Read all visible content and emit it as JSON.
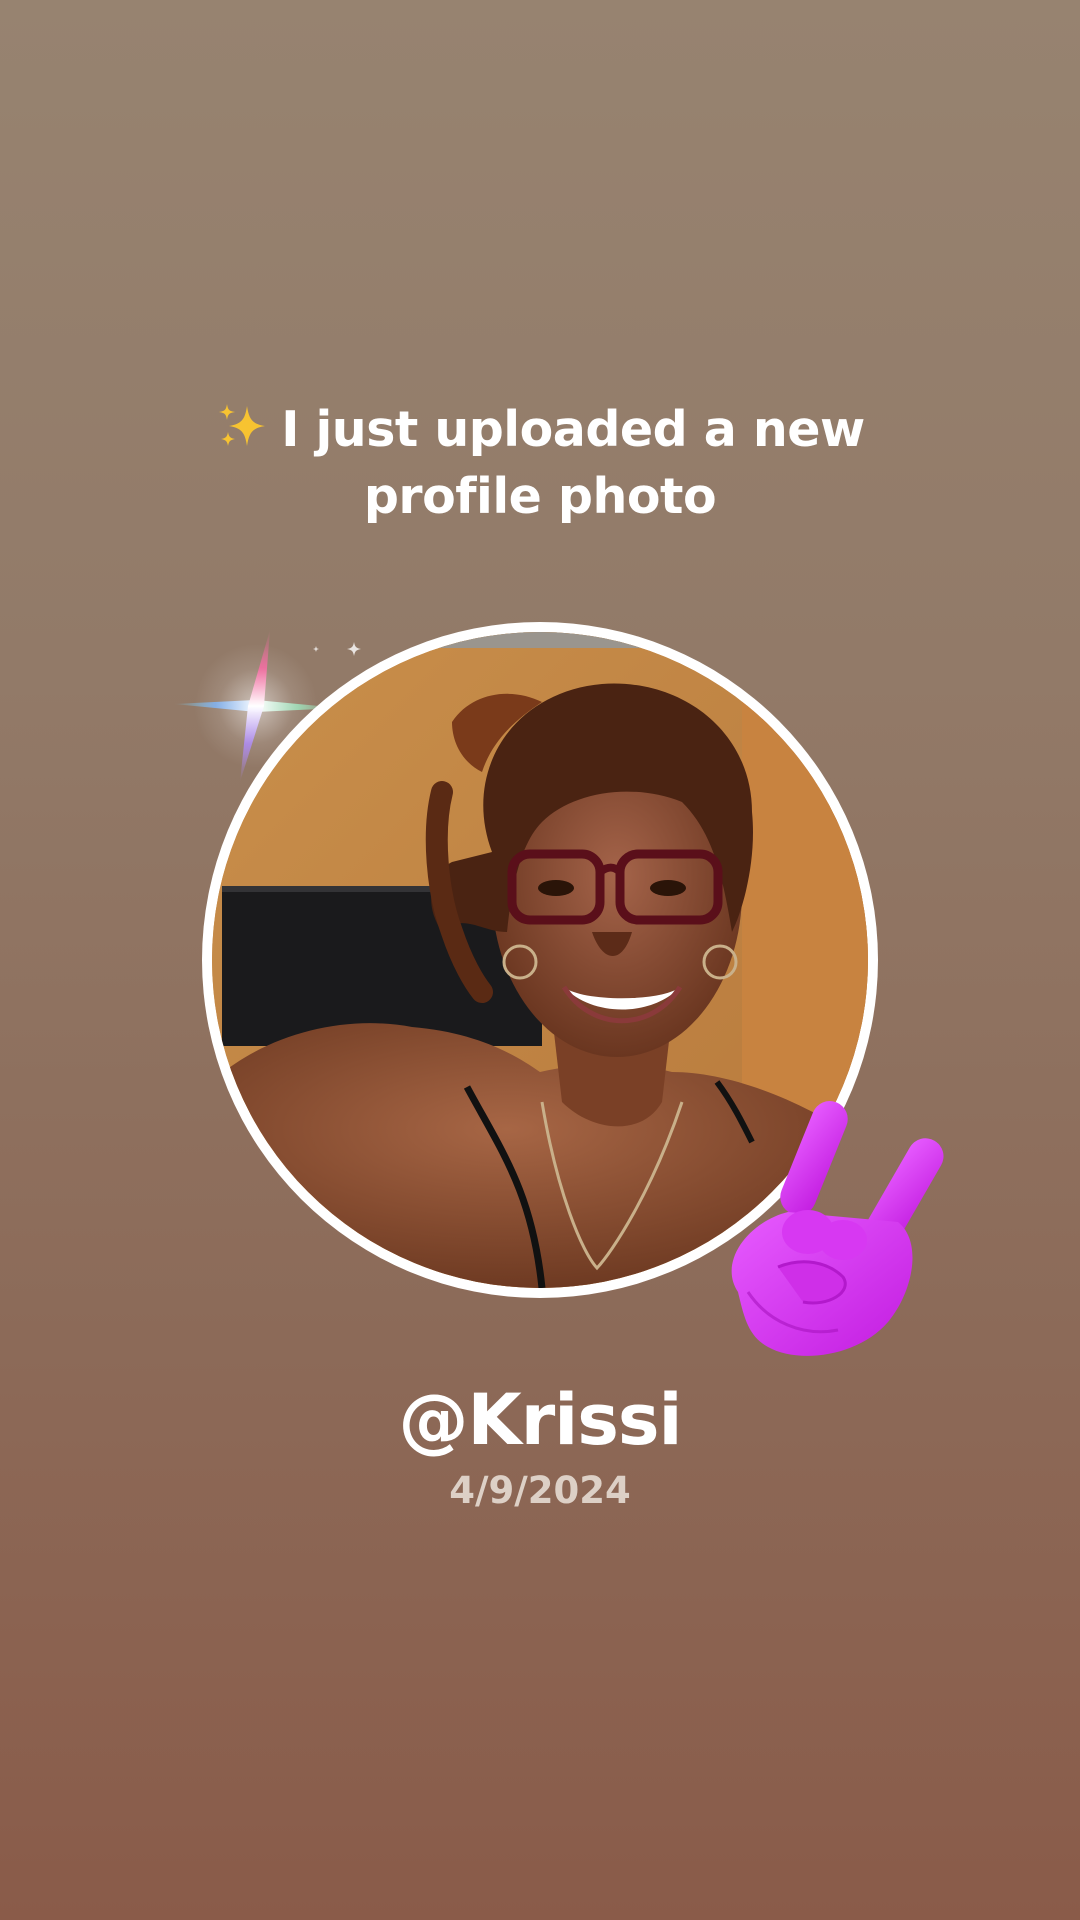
{
  "post": {
    "headline": "I just uploaded a new profile photo",
    "headline_icon": "sparkles-icon",
    "username": "@Krissi",
    "date": "4/9/2024"
  },
  "decorations": {
    "sparkle_flare_icon": "sparkle-flare-icon",
    "sticker_icon": "sign-of-the-horns-icon",
    "sticker_color": "#d631f0"
  },
  "theme": {
    "background_top": "#978370",
    "background_bottom": "#8a5b49",
    "text_color": "#ffffff",
    "date_color": "#ddd0c6",
    "avatar_ring_color": "#ffffff"
  }
}
